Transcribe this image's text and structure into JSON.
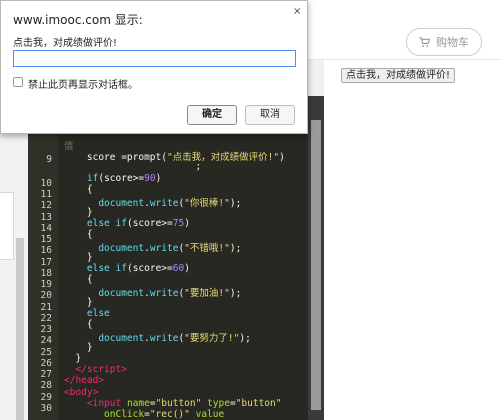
{
  "dialog": {
    "title": "www.imooc.com 显示:",
    "close_glyph": "×",
    "message": "点击我，对成绩做评价!",
    "input_value": "",
    "checkbox_label": "禁止此页再显示对话框。",
    "ok_label": "确定",
    "cancel_label": "取消"
  },
  "header": {
    "cart_label": "购物车",
    "cart_icon": "cart-icon"
  },
  "preview": {
    "button_label": "点击我，对成绩做评价!"
  },
  "editor": {
    "partial_top": "值",
    "line_numbers": [
      "9",
      "",
      "10",
      "11",
      "12",
      "13",
      "14",
      "15",
      "16",
      "17",
      "18",
      "19",
      "20",
      "21",
      "22",
      "23",
      "24",
      "25",
      "26",
      "27",
      "28",
      "29",
      "30"
    ]
  }
}
